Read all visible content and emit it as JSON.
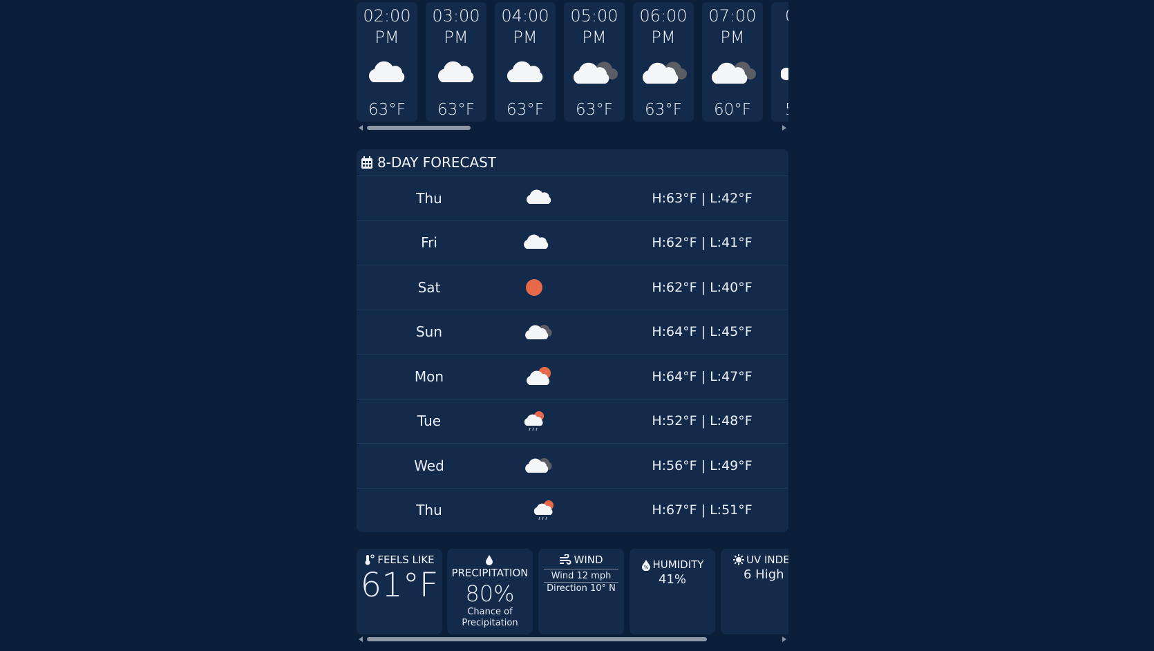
{
  "hourly": [
    {
      "time_line1": "02:00",
      "time_line2": "PM",
      "icon": "cloud-icon",
      "temp": "63°F"
    },
    {
      "time_line1": "03:00",
      "time_line2": "PM",
      "icon": "cloud-icon",
      "temp": "63°F"
    },
    {
      "time_line1": "04:00",
      "time_line2": "PM",
      "icon": "cloud-icon",
      "temp": "63°F"
    },
    {
      "time_line1": "05:00",
      "time_line2": "PM",
      "icon": "overcast-cloud-icon",
      "temp": "63°F"
    },
    {
      "time_line1": "06:00",
      "time_line2": "PM",
      "icon": "overcast-cloud-icon",
      "temp": "63°F"
    },
    {
      "time_line1": "07:00",
      "time_line2": "PM",
      "icon": "overcast-cloud-icon",
      "temp": "60°F"
    },
    {
      "time_line1": "0",
      "time_line2": "",
      "icon": "cloud-icon",
      "temp": "5"
    }
  ],
  "daily": {
    "title": "8-DAY FORECAST",
    "days": [
      {
        "day": "Thu",
        "icon": "cloud-icon",
        "hl": "H:63°F | L:42°F"
      },
      {
        "day": "Fri",
        "icon": "cloud-icon",
        "hl": "H:62°F | L:41°F"
      },
      {
        "day": "Sat",
        "icon": "sun-icon",
        "hl": "H:62°F | L:40°F"
      },
      {
        "day": "Sun",
        "icon": "overcast-cloud-icon",
        "hl": "H:64°F | L:45°F"
      },
      {
        "day": "Mon",
        "icon": "partly-sunny-icon",
        "hl": "H:64°F | L:47°F"
      },
      {
        "day": "Tue",
        "icon": "sun-rain-icon",
        "hl": "H:52°F | L:48°F"
      },
      {
        "day": "Wed",
        "icon": "overcast-cloud-icon",
        "hl": "H:56°F | L:49°F"
      },
      {
        "day": "Thu",
        "icon": "sun-rain-icon",
        "hl": "H:67°F | L:51°F"
      }
    ]
  },
  "details": {
    "feels_like": {
      "title": "FEELS LIKE",
      "value": "61°F"
    },
    "precipitation": {
      "title": "PRECIPITATION",
      "value": "80%",
      "caption": "Chance of Precipitation"
    },
    "wind": {
      "title": "WIND",
      "speed": "Wind 12 mph",
      "direction": "Direction 10° N"
    },
    "humidity": {
      "title": "HUMIDITY",
      "value": "41%"
    },
    "uv": {
      "title": "UV INDEX",
      "value": "6 High"
    }
  },
  "colors": {
    "background": "#0b1f3b",
    "card": "#142a4a",
    "sun": "#e8694a",
    "text": "#e8eef7"
  }
}
